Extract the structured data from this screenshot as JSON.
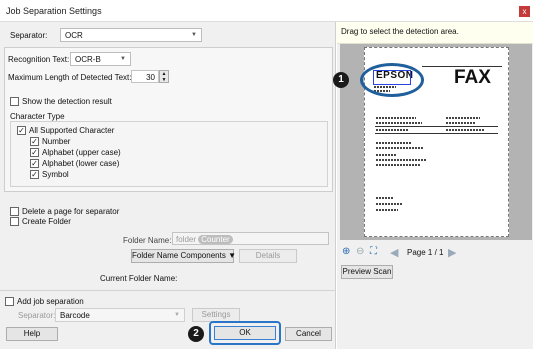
{
  "window": {
    "title": "Job Separation Settings",
    "close_glyph": "x"
  },
  "separator": {
    "label": "Separator:",
    "value": "OCR"
  },
  "recognition": {
    "label": "Recognition Text:",
    "value": "OCR-B"
  },
  "max_length": {
    "label": "Maximum Length of Detected Text:",
    "value": "30"
  },
  "show_detection": {
    "label": "Show the detection result",
    "checked": false
  },
  "character_type": {
    "heading": "Character Type",
    "all_label": "All Supported Character",
    "items": [
      {
        "label": "Number",
        "checked": true
      },
      {
        "label": "Alphabet (upper case)",
        "checked": true
      },
      {
        "label": "Alphabet (lower case)",
        "checked": true
      },
      {
        "label": "Symbol",
        "checked": true
      }
    ]
  },
  "delete_page": {
    "label": "Delete a page for separator"
  },
  "create_folder": {
    "label": "Create Folder"
  },
  "folder_name": {
    "label": "Folder Name:",
    "prefix": "folder",
    "token": "Counter"
  },
  "folder_components": {
    "label": "Folder Name Components",
    "arrow": "▼"
  },
  "details_button": "Details",
  "current_folder": {
    "label": "Current Folder Name:"
  },
  "add_job": {
    "label": "Add job separation"
  },
  "separator2": {
    "label": "Separator:",
    "value": "Barcode"
  },
  "settings_button": "Settings",
  "help_button": "Help",
  "ok_button": "OK",
  "cancel_button": "Cancel",
  "right": {
    "hint": "Drag to select the detection area.",
    "preview_scan": "Preview Scan",
    "page_indicator": "Page 1 / 1"
  },
  "document": {
    "logo": "EPSON",
    "heading": "FAX"
  },
  "callouts": [
    "1",
    "2"
  ],
  "colors": {
    "highlight": "#1f5f9c",
    "callout": "#1a1a1a",
    "ok_border": "#2a75c8"
  }
}
